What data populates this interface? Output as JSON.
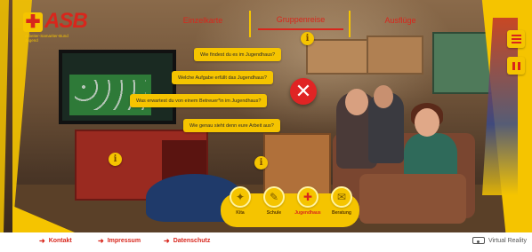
{
  "logo": {
    "text": "ASB",
    "subtitle": "Arbeiter-Samariter-Bund Jugend"
  },
  "topnav": {
    "tabs": [
      {
        "label": "Einzelkarte"
      },
      {
        "label": "Gruppenreise"
      },
      {
        "label": "Ausflüge"
      }
    ]
  },
  "questions": [
    {
      "text": "Wie findest du es im Jugendhaus?"
    },
    {
      "text": "Welche Aufgabe erfüllt das Jugendhaus?"
    },
    {
      "text": "Was erwartest du von einem Betreuer*in im Jugendhaus?"
    },
    {
      "text": "Wie genau sieht denn eure Arbeit aus?"
    }
  ],
  "info_glyph": "i",
  "close_glyph": "✕",
  "categories": [
    {
      "label": "Kita",
      "icon": "puzzle-icon"
    },
    {
      "label": "Schule",
      "icon": "school-icon"
    },
    {
      "label": "Jugendhaus",
      "icon": "gamepad-icon",
      "active": true
    },
    {
      "label": "Beratung",
      "icon": "chat-icon"
    }
  ],
  "footer": {
    "links": [
      {
        "label": "Kontakt"
      },
      {
        "label": "Impressum"
      },
      {
        "label": "Datenschutz"
      }
    ],
    "vr_label": "Virtual Reality"
  },
  "colors": {
    "accent_yellow": "#f5c400",
    "brand_red": "#d8261c",
    "close_red": "#e02424"
  }
}
